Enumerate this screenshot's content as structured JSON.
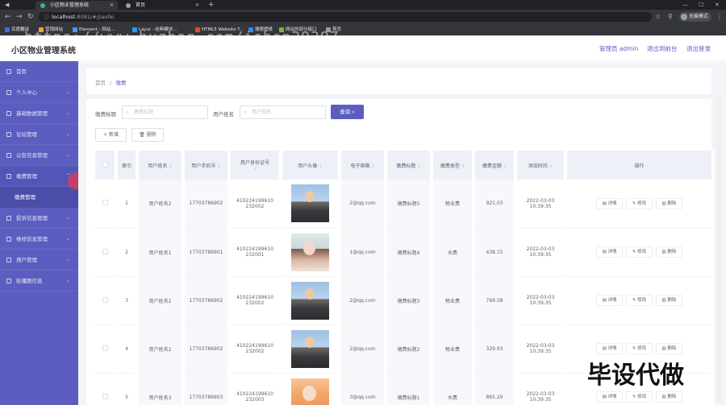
{
  "browser": {
    "tabs": [
      {
        "title": "小区物业管理系统",
        "color": "#41b883"
      },
      {
        "title": "首页",
        "color": "#9aa0a6"
      }
    ],
    "address": {
      "host": "localhost",
      "path": ":8081/#/jiaofei"
    },
    "profile_label": "无痕模式",
    "bookmarks": [
      {
        "label": "百度翻译",
        "color": "#3b6de8"
      },
      {
        "label": "营销网站",
        "color": "#e8a33b"
      },
      {
        "label": "Element - 网站...",
        "color": "#409eff"
      },
      {
        "label": "Layui - 经典模块...",
        "color": "#1e9fff"
      },
      {
        "label": "HTML5 Website T...",
        "color": "#e34c26"
      },
      {
        "label": "搜索壁纸",
        "color": "#2d8cf0"
      },
      {
        "label": "网站的部分接口",
        "color": "#7cb342"
      },
      {
        "label": "首页",
        "color": "#9aa0a6"
      }
    ]
  },
  "watermark": "https://www.huzhan.com/ishop39397",
  "stamp": "毕设代做",
  "header": {
    "title": "小区物业管理系统",
    "admin": "管理员 admin",
    "front": "退出到前台",
    "logout": "退出登录"
  },
  "sidebar": {
    "items": [
      {
        "label": "首页"
      },
      {
        "label": "个人中心"
      },
      {
        "label": "基础数据管理"
      },
      {
        "label": "论坛管理"
      },
      {
        "label": "公告信息管理"
      },
      {
        "label": "缴费管理"
      },
      {
        "label": "投诉信息管理"
      },
      {
        "label": "维修信息管理"
      },
      {
        "label": "用户管理"
      },
      {
        "label": "轮播图信息"
      }
    ],
    "submenu_label": "缴费管理"
  },
  "breadcrumb": {
    "home": "首页",
    "sep": "/",
    "current": "缴费"
  },
  "search": {
    "title_label": "缴费标题",
    "title_placeholder": "缴费标题",
    "name_label": "用户姓名",
    "name_placeholder": "用户姓名",
    "query_button": "查询"
  },
  "toolbar": {
    "add": "新增",
    "delete": "删除"
  },
  "table": {
    "headers": [
      "索引",
      "用户姓名",
      "用户手机号",
      "用户身份证号",
      "用户头像",
      "电子邮箱",
      "缴费标题",
      "缴费类型",
      "缴费金额",
      "添加时间",
      "操作"
    ],
    "actions": {
      "detail": "详情",
      "edit": "修改",
      "delete": "删除"
    },
    "rows": [
      {
        "index": "1",
        "name": "用户姓名2",
        "phone": "17703786902",
        "id_card": "410224199610 232002",
        "avatar": "av-a",
        "email": "2@qq.com",
        "title": "缴费标题5",
        "type": "物业费",
        "amount": "921.03",
        "time": "2022-03-03 10:39:35"
      },
      {
        "index": "2",
        "name": "用户姓名1",
        "phone": "17703786901",
        "id_card": "410224199610 232001",
        "avatar": "av-b",
        "email": "1@qq.com",
        "title": "缴费标题4",
        "type": "水费",
        "amount": "438.15",
        "time": "2022-03-03 10:39:35"
      },
      {
        "index": "3",
        "name": "用户姓名2",
        "phone": "17703786902",
        "id_card": "410224199610 232002",
        "avatar": "av-a",
        "email": "2@qq.com",
        "title": "缴费标题3",
        "type": "物业费",
        "amount": "769.58",
        "time": "2022-03-03 10:39:35"
      },
      {
        "index": "4",
        "name": "用户姓名2",
        "phone": "17703786902",
        "id_card": "410224199610 232002",
        "avatar": "av-a",
        "email": "2@qq.com",
        "title": "缴费标题2",
        "type": "物业费",
        "amount": "329.93",
        "time": "2022-03-03 10:39:35"
      },
      {
        "index": "5",
        "name": "用户姓名3",
        "phone": "17703786903",
        "id_card": "410224199610 232003",
        "avatar": "av-c",
        "email": "3@qq.com",
        "title": "缴费标题1",
        "type": "水费",
        "amount": "865.29",
        "time": "2022-03-03 10:39:35"
      }
    ]
  },
  "colors": {
    "sidebar": "#5b5ebf",
    "accent": "#5b5fc7",
    "browser_dark": "#202124"
  }
}
